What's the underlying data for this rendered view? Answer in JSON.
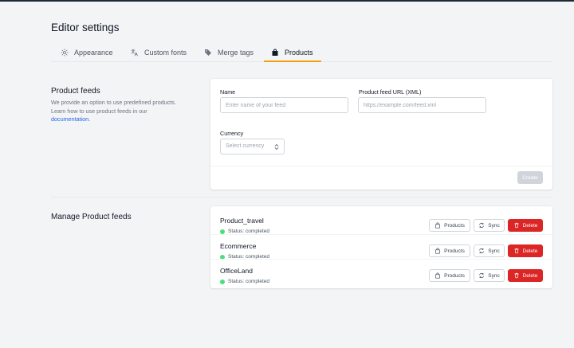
{
  "page_title": "Editor settings",
  "tabs": [
    {
      "label": "Appearance",
      "icon": "sun-icon"
    },
    {
      "label": "Custom fonts",
      "icon": "translate-icon"
    },
    {
      "label": "Merge tags",
      "icon": "tag-icon"
    },
    {
      "label": "Products",
      "icon": "shopping-bag-icon",
      "active": true
    }
  ],
  "product_feeds": {
    "title": "Product feeds",
    "description": "We provide an option to use predefined products. Learn how to use product feeds in our",
    "link_text": "documentation",
    "name_label": "Name",
    "name_placeholder": "Enter name of your feed",
    "url_label": "Product feed URL (XML)",
    "url_placeholder": "https://example.com/feed.xml",
    "currency_label": "Currency",
    "currency_placeholder": "Select currency",
    "create_label": "Create"
  },
  "manage": {
    "title": "Manage Product feeds",
    "feeds": [
      {
        "name": "Product_travel",
        "status": "Status: completed"
      },
      {
        "name": "Ecommerce",
        "status": "Status: completed"
      },
      {
        "name": "OfficeLand",
        "status": "Status: completed"
      }
    ],
    "products_label": "Products",
    "sync_label": "Sync",
    "delete_label": "Delete"
  },
  "colors": {
    "accent": "#f59e0b",
    "delete": "#dc2626",
    "status_ok": "#4ade80",
    "link": "#2563eb"
  }
}
